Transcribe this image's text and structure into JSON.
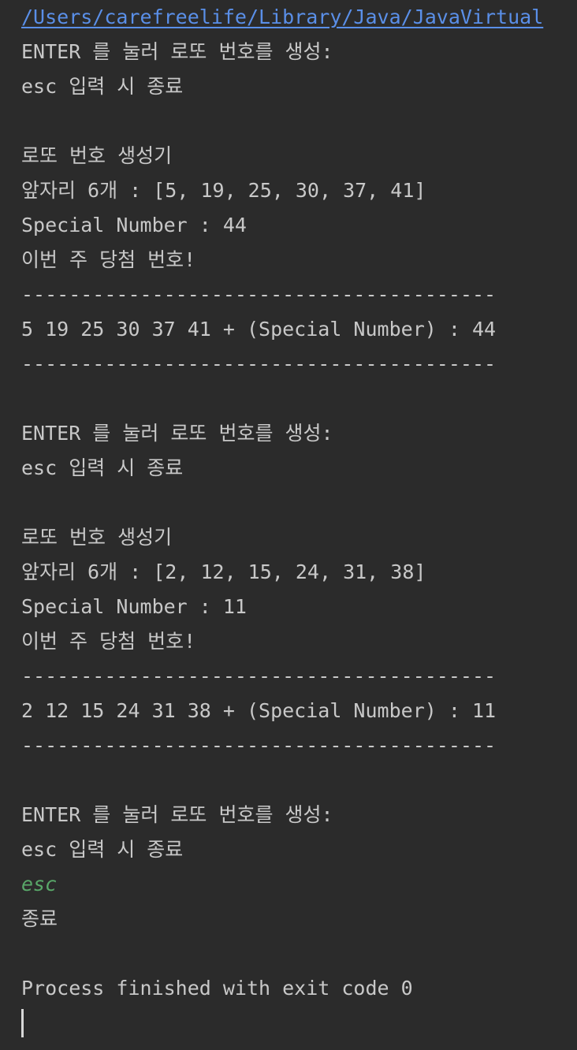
{
  "console": {
    "path_link": "/Users/carefreelife/Library/Java/JavaVirtual",
    "rounds": [
      {
        "prompt": "ENTER 를 눌러 로또 번호를 생성:",
        "esc_hint": "esc 입력 시 종료",
        "generator_title": "로또 번호 생성기",
        "front_numbers": "앞자리 6개 : [5, 19, 25, 30, 37, 41]",
        "special_number": "Special Number : 44",
        "winning_heading": "이번 주 당첨 번호!",
        "divider_top": "----------------------------------------",
        "result": "5 19 25 30 37 41 + (Special Number) : 44",
        "divider_bottom": "----------------------------------------"
      },
      {
        "prompt": "ENTER 를 눌러 로또 번호를 생성:",
        "esc_hint": "esc 입력 시 종료",
        "generator_title": "로또 번호 생성기",
        "front_numbers": "앞자리 6개 : [2, 12, 15, 24, 31, 38]",
        "special_number": "Special Number : 11",
        "winning_heading": "이번 주 당첨 번호!",
        "divider_top": "----------------------------------------",
        "result": "2 12 15 24 31 38 + (Special Number) : 11",
        "divider_bottom": "----------------------------------------"
      }
    ],
    "final_prompt": "ENTER 를 눌러 로또 번호를 생성:",
    "final_esc_hint": "esc 입력 시 종료",
    "user_input": "esc",
    "exit_message": "종료",
    "process_message": "Process finished with exit code 0"
  },
  "colors": {
    "background": "#2b2b2b",
    "text": "#c8c8c8",
    "link": "#5a8fe8",
    "user_input": "#59a869"
  }
}
